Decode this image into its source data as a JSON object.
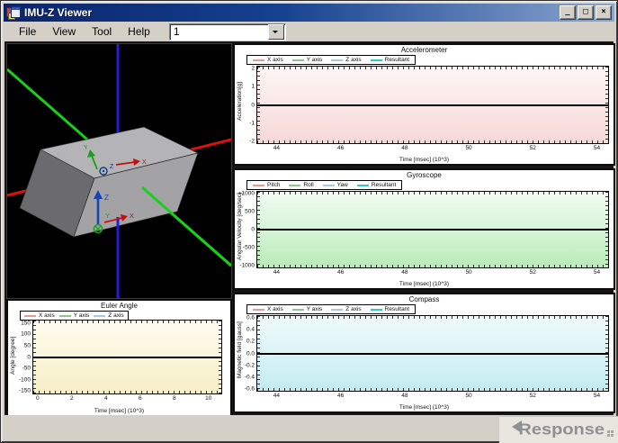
{
  "window": {
    "title": "IMU-Z Viewer",
    "controls": {
      "minimize": "_",
      "maximize": "□",
      "close": "×"
    }
  },
  "menu": {
    "items": [
      "File",
      "View",
      "Tool",
      "Help"
    ],
    "device_combo": {
      "value": "1"
    }
  },
  "viewer3d": {
    "background": "#000000",
    "axes": {
      "x_color": "#e01010",
      "y_color": "#18d018",
      "z_color": "#2020d8"
    },
    "box_colors": {
      "top": "#b4b4b6",
      "left": "#6b6b6d",
      "front": "#a3a3a5"
    },
    "top_face_labels": {
      "x": "X",
      "y": "Y",
      "z": "Z"
    },
    "front_face_labels": {
      "x": "X",
      "y": "Y",
      "z": "Z"
    }
  },
  "charts": [
    {
      "id": "accelerometer",
      "type": "line",
      "title": "Accelerometer",
      "xlabel": "Time [msec] (10^3)",
      "ylabel": "Acceleration[g]",
      "xlim": [
        43.4,
        54.35
      ],
      "ylim": [
        -2.1,
        2.1
      ],
      "xticks": [
        {
          "label": "44",
          "v": 44
        },
        {
          "label": "46",
          "v": 46
        },
        {
          "label": "48",
          "v": 48
        },
        {
          "label": "50",
          "v": 50
        },
        {
          "label": "52",
          "v": 52
        },
        {
          "label": "54",
          "v": 54
        }
      ],
      "yticks": [
        {
          "label": "2",
          "v": 2
        },
        {
          "label": "1",
          "v": 1
        },
        {
          "label": "0",
          "v": 0
        },
        {
          "label": "-1",
          "v": -1
        },
        {
          "label": "-2",
          "v": -2
        }
      ],
      "legend": [
        {
          "label": "X axis",
          "color": "#e59a9a"
        },
        {
          "label": "Y axis",
          "color": "#8cc88c"
        },
        {
          "label": "Z axis",
          "color": "#a9c7dd"
        },
        {
          "label": "Resultant",
          "color": "#2fc9c9"
        }
      ],
      "plot_bg_top": "#fdf6f5",
      "plot_bg_bottom": "#f5d8d6",
      "zero_line": true,
      "series": []
    },
    {
      "id": "gyroscope",
      "type": "line",
      "title": "Gyroscope",
      "xlabel": "Time [msec] (10^3)",
      "ylabel": "Angular Velocity [deg/sec]",
      "xlim": [
        43.4,
        54.35
      ],
      "ylim": [
        -1050,
        1050
      ],
      "xticks": [
        {
          "label": "44",
          "v": 44
        },
        {
          "label": "46",
          "v": 46
        },
        {
          "label": "48",
          "v": 48
        },
        {
          "label": "50",
          "v": 50
        },
        {
          "label": "52",
          "v": 52
        },
        {
          "label": "54",
          "v": 54
        }
      ],
      "yticks": [
        {
          "label": "+1000",
          "v": 1000
        },
        {
          "label": "500",
          "v": 500
        },
        {
          "label": "0",
          "v": 0
        },
        {
          "label": "-500",
          "v": -500
        },
        {
          "label": "-1000",
          "v": -1000
        }
      ],
      "legend": [
        {
          "label": "Pitch",
          "color": "#e59a9a"
        },
        {
          "label": "Roll",
          "color": "#8cc88c"
        },
        {
          "label": "Yaw",
          "color": "#a9c7dd"
        },
        {
          "label": "Resultant",
          "color": "#2fc9c9"
        }
      ],
      "plot_bg_top": "#f3fcf3",
      "plot_bg_bottom": "#b9ecb9",
      "zero_line": true,
      "series": []
    },
    {
      "id": "euler-angle",
      "type": "line",
      "title": "Euler Angle",
      "xlabel": "Time [msec] (10^3)",
      "ylabel": "Angle [degree]",
      "xlim": [
        -0.25,
        10.75
      ],
      "ylim": [
        -160,
        160
      ],
      "xticks": [
        {
          "label": "0",
          "v": 0
        },
        {
          "label": "2",
          "v": 2
        },
        {
          "label": "4",
          "v": 4
        },
        {
          "label": "6",
          "v": 6
        },
        {
          "label": "8",
          "v": 8
        },
        {
          "label": "10",
          "v": 10
        }
      ],
      "yticks": [
        {
          "label": "150",
          "v": 150
        },
        {
          "label": "100",
          "v": 100
        },
        {
          "label": "50",
          "v": 50
        },
        {
          "label": "0",
          "v": 0
        },
        {
          "label": "-50",
          "v": -50
        },
        {
          "label": "-100",
          "v": -100
        },
        {
          "label": "-150",
          "v": -150
        }
      ],
      "legend": [
        {
          "label": "X axis",
          "color": "#e59a9a"
        },
        {
          "label": "Y axis",
          "color": "#8cc88c"
        },
        {
          "label": "Z axis",
          "color": "#a9c7dd"
        }
      ],
      "plot_bg_top": "#fefcf1",
      "plot_bg_bottom": "#f6eec5",
      "zero_line": true,
      "series": []
    },
    {
      "id": "compass",
      "type": "line",
      "title": "Compass",
      "xlabel": "Time [msec] (10^3)",
      "ylabel": "Magnetic field [gauss]",
      "xlim": [
        43.4,
        54.35
      ],
      "ylim": [
        -0.63,
        0.63
      ],
      "xticks": [
        {
          "label": "44",
          "v": 44
        },
        {
          "label": "46",
          "v": 46
        },
        {
          "label": "48",
          "v": 48
        },
        {
          "label": "50",
          "v": 50
        },
        {
          "label": "52",
          "v": 52
        },
        {
          "label": "54",
          "v": 54
        }
      ],
      "yticks": [
        {
          "label": "0.6",
          "v": 0.6
        },
        {
          "label": "0.4",
          "v": 0.4
        },
        {
          "label": "0.2",
          "v": 0.2
        },
        {
          "label": "0.0",
          "v": 0
        },
        {
          "label": "-0.2",
          "v": -0.2
        },
        {
          "label": "-0.4",
          "v": -0.4
        },
        {
          "label": "-0.6",
          "v": -0.6
        }
      ],
      "legend": [
        {
          "label": "X axis",
          "color": "#e59a9a"
        },
        {
          "label": "Y axis",
          "color": "#8cc88c"
        },
        {
          "label": "Z axis",
          "color": "#a9c7dd"
        },
        {
          "label": "Resultant",
          "color": "#2fc9c9"
        }
      ],
      "plot_bg_top": "#f1fbfc",
      "plot_bg_bottom": "#c3ecf0",
      "zero_line": true,
      "series": []
    }
  ],
  "watermark": {
    "text": "Response"
  }
}
